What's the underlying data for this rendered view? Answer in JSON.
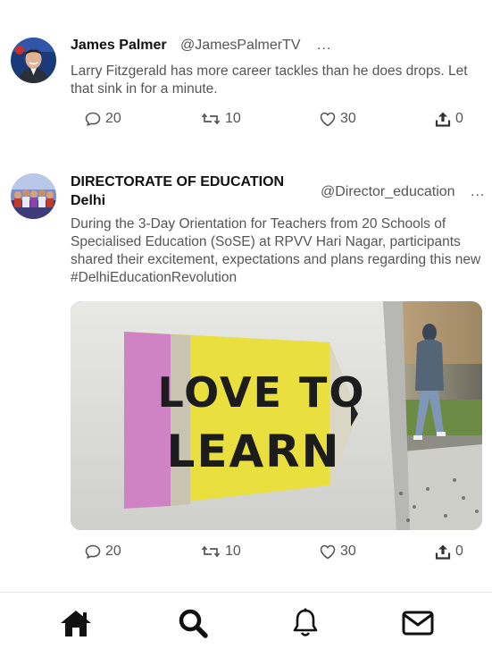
{
  "tweets": [
    {
      "author": "James Palmer",
      "handle": "@JamesPalmerTV",
      "more": "...",
      "text": "Larry Fitzgerald has more career tackles than he does drops. Let that sink in for a minute.",
      "replies": "20",
      "retweets": "10",
      "likes": "30",
      "shares": "0"
    },
    {
      "author_line1": "DIRECTORATE OF EDUCATION",
      "author_line2": "Delhi",
      "handle": "@Director_education",
      "more": "...",
      "text": "During the 3-Day Orientation for Teachers from 20 Schools of Specialised Education (SoSE) at RPVV Hari Nagar, participants shared their excitement, expectations and plans regarding this new #DelhiEducationRevolution",
      "media_sign_line1": "LOVE TO",
      "media_sign_line2": "LEARN",
      "replies": "20",
      "retweets": "10",
      "likes": "30",
      "shares": "0"
    }
  ],
  "nav": {
    "items": [
      "home-icon",
      "search-icon",
      "bell-icon",
      "mail-icon"
    ]
  }
}
